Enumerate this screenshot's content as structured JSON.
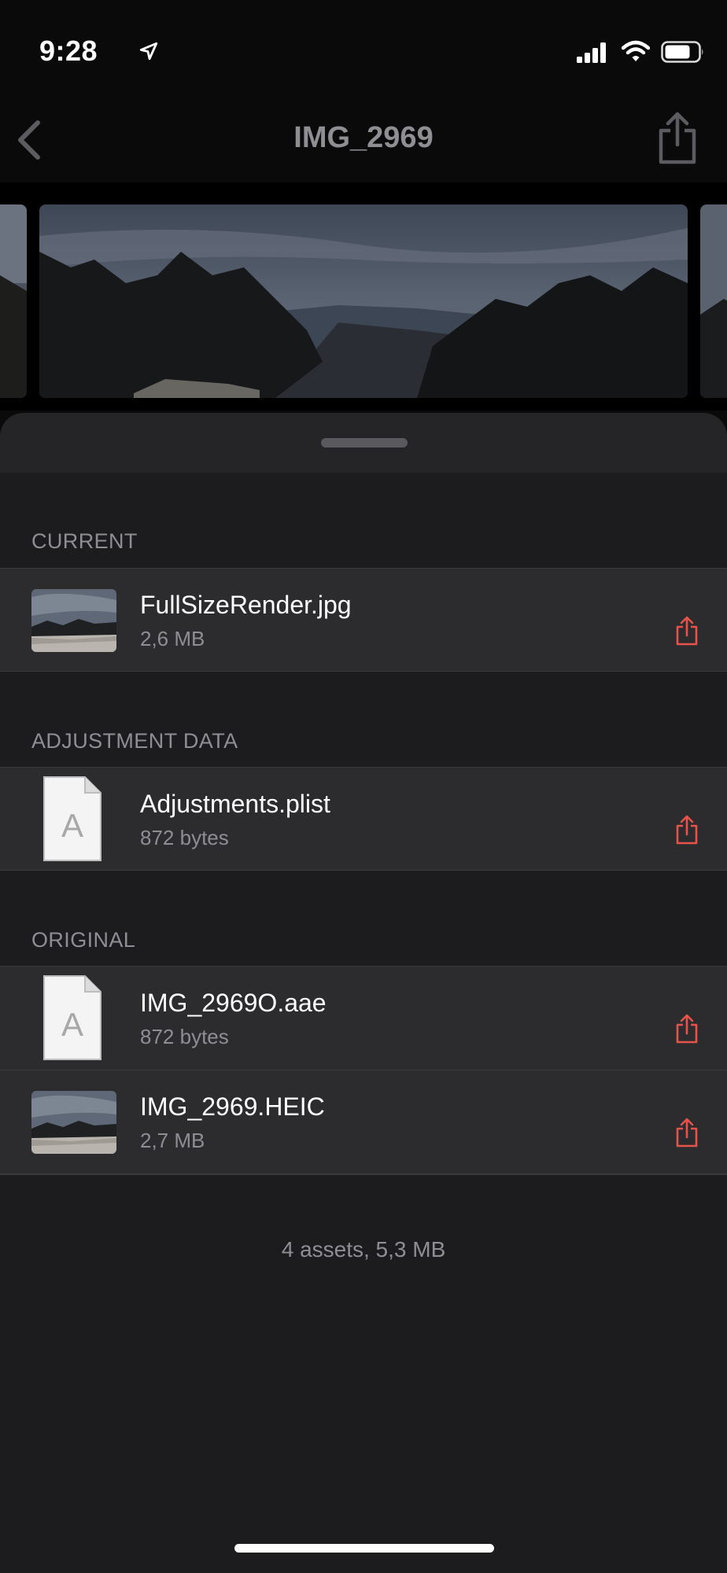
{
  "status_bar": {
    "time": "9:28"
  },
  "nav": {
    "title": "IMG_2969"
  },
  "sections": [
    {
      "label": "CURRENT",
      "items": [
        {
          "name": "FullSizeRender.jpg",
          "size": "2,6 MB",
          "icon": "photo-thumbnail"
        }
      ]
    },
    {
      "label": "ADJUSTMENT DATA",
      "items": [
        {
          "name": "Adjustments.plist",
          "size": "872 bytes",
          "icon": "document-icon"
        }
      ]
    },
    {
      "label": "ORIGINAL",
      "items": [
        {
          "name": "IMG_2969O.aae",
          "size": "872 bytes",
          "icon": "document-icon"
        },
        {
          "name": "IMG_2969.HEIC",
          "size": "2,7 MB",
          "icon": "photo-thumbnail"
        }
      ]
    }
  ],
  "footer": {
    "summary": "4 assets, 5,3 MB"
  },
  "colors": {
    "background": "#1c1c1e",
    "row": "#2c2c2e",
    "accent_share": "#e5534b",
    "secondary_text": "#8e8e93"
  }
}
